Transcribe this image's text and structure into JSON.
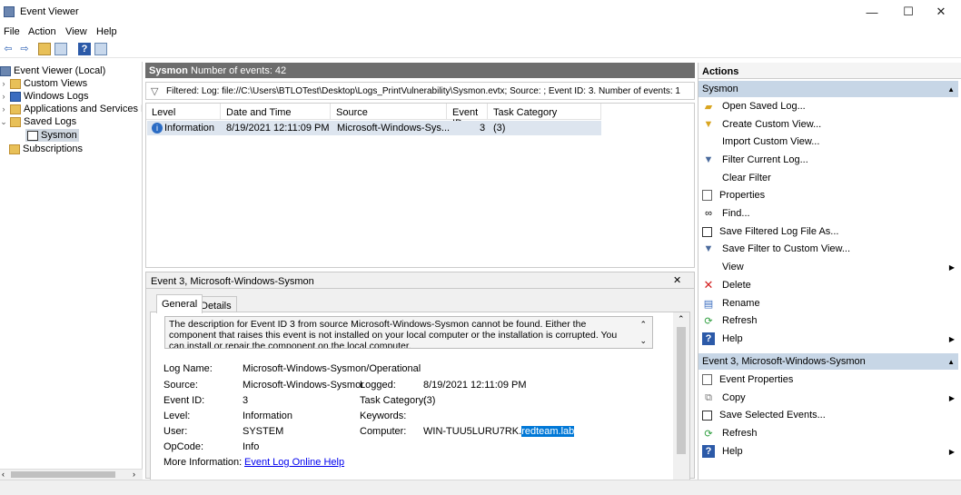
{
  "window": {
    "title": "Event Viewer",
    "minimize": "—",
    "maximize": "☐",
    "close": "✕"
  },
  "menu": [
    "File",
    "Action",
    "View",
    "Help"
  ],
  "tree": {
    "root": "Event Viewer (Local)",
    "custom_views": "Custom Views",
    "windows_logs": "Windows Logs",
    "apps_services": "Applications and Services Lo",
    "saved_logs": "Saved Logs",
    "sysmon": "Sysmon",
    "subscriptions": "Subscriptions"
  },
  "center": {
    "log_name": "Sysmon",
    "event_count": "Number of events: 42",
    "filter_text": "Filtered: Log: file://C:\\Users\\BTLOTest\\Desktop\\Logs_PrintVulnerability\\Sysmon.evtx; Source: ; Event ID: 3. Number of events: 1",
    "columns": [
      "Level",
      "Date and Time",
      "Source",
      "Event ID",
      "Task Category"
    ],
    "rows": [
      {
        "level": "Information",
        "datetime": "8/19/2021 12:11:09 PM",
        "source": "Microsoft-Windows-Sys...",
        "event_id": "3",
        "task": "(3)"
      }
    ]
  },
  "detail": {
    "title": "Event 3, Microsoft-Windows-Sysmon",
    "close": "✕",
    "tabs": [
      "General",
      "Details"
    ],
    "description": "The description for Event ID 3 from source Microsoft-Windows-Sysmon cannot be found. Either the component that raises this event is not installed on your local computer or the installation is corrupted. You can install or repair the component on the local computer.",
    "fields": {
      "log_name_label": "Log Name:",
      "log_name": "Microsoft-Windows-Sysmon/Operational",
      "source_label": "Source:",
      "source": "Microsoft-Windows-Sysmor",
      "logged_label": "Logged:",
      "logged": "8/19/2021 12:11:09 PM",
      "event_id_label": "Event ID:",
      "event_id": "3",
      "task_label": "Task Category:",
      "task": "(3)",
      "level_label": "Level:",
      "level": "Information",
      "keywords_label": "Keywords:",
      "user_label": "User:",
      "user": "SYSTEM",
      "computer_label": "Computer:",
      "computer_a": "WIN-TUU5LURU7RK.",
      "computer_b": "redteam.lab",
      "opcode_label": "OpCode:",
      "opcode": "Info",
      "more_info_label": "More Information:",
      "more_info_link": "Event Log Online Help"
    }
  },
  "actions": {
    "title": "Actions",
    "section1": "Sysmon",
    "items1": [
      "Open Saved Log...",
      "Create Custom View...",
      "Import Custom View...",
      "Filter Current Log...",
      "Clear Filter",
      "Properties",
      "Find...",
      "Save Filtered Log File As...",
      "Save Filter to Custom View...",
      "View",
      "Delete",
      "Rename",
      "Refresh",
      "Help"
    ],
    "section2": "Event 3, Microsoft-Windows-Sysmon",
    "items2": [
      "Event Properties",
      "Copy",
      "Save Selected Events...",
      "Refresh",
      "Help"
    ]
  }
}
